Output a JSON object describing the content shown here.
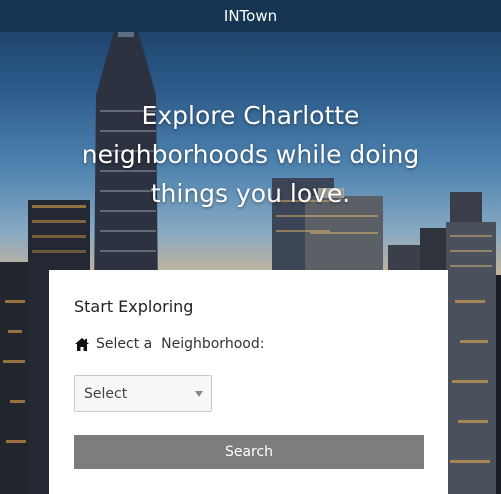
{
  "app": {
    "title": "INTown"
  },
  "hero": {
    "headline_line1": "Explore Charlotte",
    "headline_line2": "neighborhoods while doing",
    "headline_line3": "things you love."
  },
  "search_card": {
    "title": "Start Exploring",
    "neighborhood_label": "Select a  Neighborhood:",
    "label_icon": "home-icon",
    "select_value": "Select",
    "search_label": "Search"
  },
  "colors": {
    "topbar": "#163553",
    "card": "#ffffff",
    "button": "#7d7d7d",
    "headline_text": "#ffffff"
  }
}
